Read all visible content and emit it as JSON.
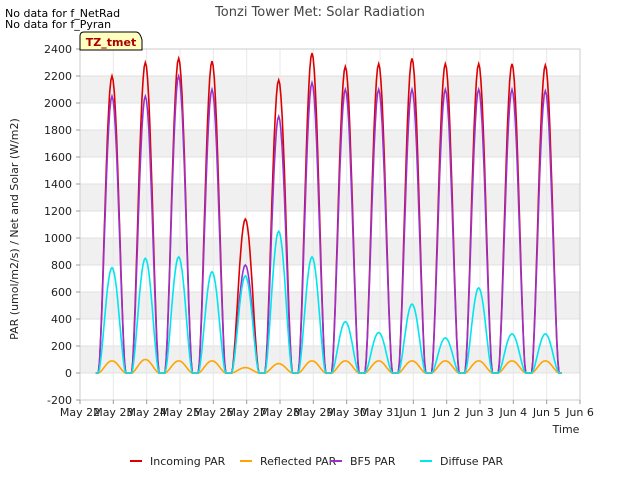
{
  "notes": [
    "No data for f_NetRad",
    "No data for f_Pyran"
  ],
  "chart_data": {
    "type": "line",
    "title": "Tonzi Tower Met: Solar Radiation",
    "xlabel": "Time",
    "ylabel": "PAR (umol/m2/s) / Net and Solar (W/m2)",
    "legend_box": "TZ_tmet",
    "ylim": [
      -200,
      2400
    ],
    "yticks": [
      -200,
      0,
      200,
      400,
      600,
      800,
      1000,
      1200,
      1400,
      1600,
      1800,
      2000,
      2200,
      2400
    ],
    "xlim": [
      0,
      15
    ],
    "xticks": [
      {
        "value": 0,
        "label": "May 22"
      },
      {
        "value": 1,
        "label": "May 23"
      },
      {
        "value": 2,
        "label": "May 24"
      },
      {
        "value": 3,
        "label": "May 25"
      },
      {
        "value": 4,
        "label": "May 26"
      },
      {
        "value": 5,
        "label": "May 27"
      },
      {
        "value": 6,
        "label": "May 28"
      },
      {
        "value": 7,
        "label": "May 29"
      },
      {
        "value": 8,
        "label": "May 30"
      },
      {
        "value": 9,
        "label": "May 31"
      },
      {
        "value": 10,
        "label": "Jun 1"
      },
      {
        "value": 11,
        "label": "Jun 2"
      },
      {
        "value": 12,
        "label": "Jun 3"
      },
      {
        "value": 13,
        "label": "Jun 4"
      },
      {
        "value": 14,
        "label": "Jun 5"
      },
      {
        "value": 15,
        "label": "Jun 6"
      }
    ],
    "grid": true,
    "legend_position": "bottom",
    "series": [
      {
        "name": "Incoming PAR",
        "color": "#dd0000",
        "daily_peak": [
          2200,
          2300,
          2330,
          2310,
          1140,
          2170,
          2370,
          2270,
          2290,
          2330,
          2290,
          2290,
          2290,
          2280
        ]
      },
      {
        "name": "Reflected PAR",
        "color": "#ffa500",
        "daily_peak": [
          90,
          100,
          90,
          90,
          40,
          70,
          90,
          90,
          90,
          90,
          90,
          90,
          90,
          90
        ]
      },
      {
        "name": "BF5 PAR",
        "color": "#9932cc",
        "daily_peak": [
          2050,
          2050,
          2200,
          2100,
          800,
          1900,
          2150,
          2100,
          2100,
          2100,
          2100,
          2100,
          2100,
          2090
        ]
      },
      {
        "name": "Diffuse PAR",
        "color": "#00e5ee",
        "daily_peak": [
          780,
          850,
          860,
          750,
          720,
          1050,
          860,
          380,
          300,
          510,
          260,
          630,
          290,
          290
        ]
      }
    ]
  }
}
